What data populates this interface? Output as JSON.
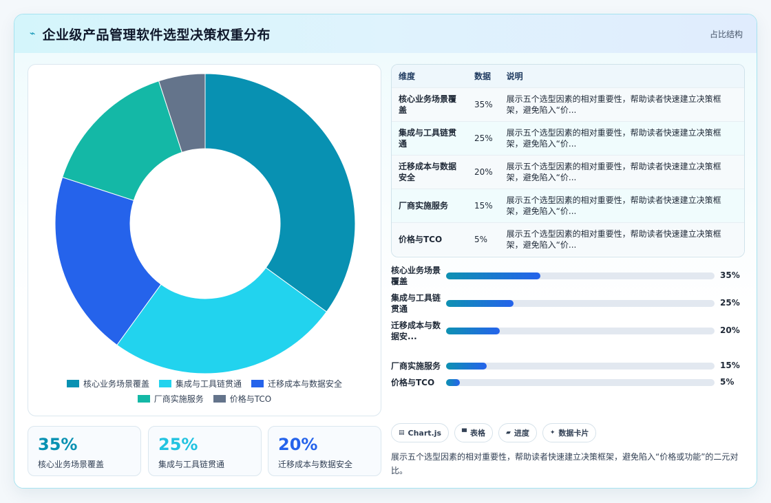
{
  "header": {
    "title": "企业级产品管理软件选型决策权重分布",
    "right_label": "占比结构",
    "icon": "lightning-icon"
  },
  "colors": {
    "accent": "#0891b2",
    "bar_start": "#0e91b2",
    "bar_end": "#2563eb"
  },
  "chart_data": {
    "type": "pie",
    "variant": "doughnut",
    "categories": [
      "核心业务场景覆盖",
      "集成与工具链贯通",
      "迁移成本与数据安全",
      "厂商实施服务",
      "价格与TCO"
    ],
    "values": [
      35,
      25,
      20,
      15,
      5
    ],
    "unit": "%",
    "colors": [
      "#0891b2",
      "#22d3ee",
      "#2563eb",
      "#14b8a6",
      "#64748b"
    ],
    "legend_position": "bottom"
  },
  "legend": [
    {
      "label": "核心业务场景覆盖",
      "color": "#0891b2"
    },
    {
      "label": "集成与工具链贯通",
      "color": "#22d3ee"
    },
    {
      "label": "迁移成本与数据安全",
      "color": "#2563eb"
    },
    {
      "label": "厂商实施服务",
      "color": "#14b8a6"
    },
    {
      "label": "价格与TCO",
      "color": "#64748b"
    }
  ],
  "stats": [
    {
      "value": "35%",
      "label": "核心业务场景覆盖",
      "color": "#0891b2"
    },
    {
      "value": "25%",
      "label": "集成与工具链贯通",
      "color": "#22c3e0"
    },
    {
      "value": "20%",
      "label": "迁移成本与数据安全",
      "color": "#2563eb"
    }
  ],
  "table": {
    "headers": [
      "维度",
      "数据",
      "说明"
    ],
    "rows": [
      {
        "dim": "核心业务场景覆盖",
        "val": "35%",
        "desc": "展示五个选型因素的相对重要性，帮助读者快速建立决策框架，避免陷入“价..."
      },
      {
        "dim": "集成与工具链贯通",
        "val": "25%",
        "desc": "展示五个选型因素的相对重要性，帮助读者快速建立决策框架，避免陷入“价..."
      },
      {
        "dim": "迁移成本与数据安全",
        "val": "20%",
        "desc": "展示五个选型因素的相对重要性，帮助读者快速建立决策框架，避免陷入“价..."
      },
      {
        "dim": "厂商实施服务",
        "val": "15%",
        "desc": "展示五个选型因素的相对重要性，帮助读者快速建立决策框架，避免陷入“价..."
      },
      {
        "dim": "价格与TCO",
        "val": "5%",
        "desc": "展示五个选型因素的相对重要性，帮助读者快速建立决策框架，避免陷入“价..."
      }
    ]
  },
  "progress": [
    {
      "label": "核心业务场景覆盖",
      "pct": "35%",
      "value": 35
    },
    {
      "label": "集成与工具链贯通",
      "pct": "25%",
      "value": 25
    },
    {
      "label": "迁移成本与数据安...",
      "pct": "20%",
      "value": 20
    },
    {
      "label": "厂商实施服务",
      "pct": "15%",
      "value": 15
    },
    {
      "label": "价格与TCO",
      "pct": "5%",
      "value": 5
    }
  ],
  "chips": [
    {
      "label": "Chart.js",
      "icon": "chart-icon",
      "glyph": "▤"
    },
    {
      "label": "表格",
      "icon": "table-icon",
      "glyph": "▀"
    },
    {
      "label": "进度",
      "icon": "progress-icon",
      "glyph": "▰"
    },
    {
      "label": "数据卡片",
      "icon": "sparkle-icon",
      "glyph": "✦"
    }
  ],
  "summary": "展示五个选型因素的相对重要性，帮助读者快速建立决策框架，避免陷入“价格或功能”的二元对比。"
}
